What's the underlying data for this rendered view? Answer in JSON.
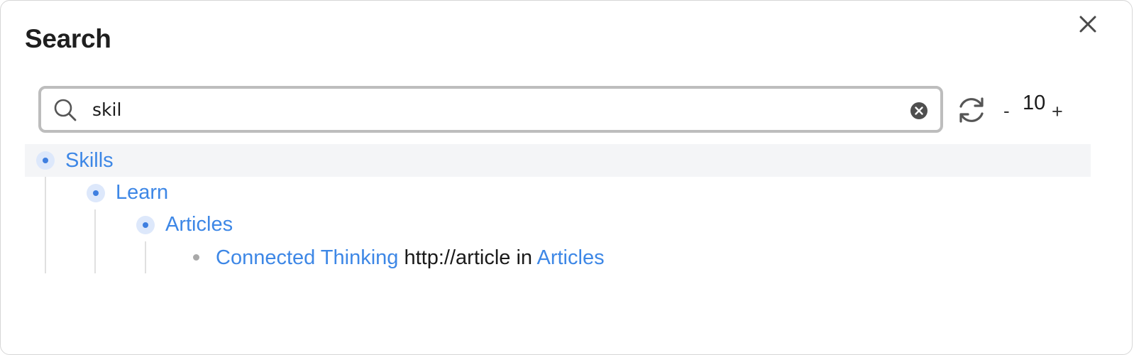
{
  "dialog": {
    "title": "Search",
    "close_icon": "close-icon"
  },
  "search": {
    "icon": "search-icon",
    "value": "skil",
    "placeholder": "",
    "clear_icon": "clear-circle-icon"
  },
  "controls": {
    "refresh_icon": "refresh-icon",
    "minus_label": "-",
    "depth_value": "10",
    "plus_label": "+"
  },
  "tree": {
    "level1": {
      "label": "Skills"
    },
    "level2": {
      "label": "Learn"
    },
    "level3": {
      "label": "Articles"
    },
    "result": {
      "title": "Connected Thinking",
      "url": "http://article",
      "in_text": "in",
      "parent": "Articles"
    }
  },
  "colors": {
    "link": "#3d87e6",
    "highlight_row": "#f4f5f7",
    "bullet_bg": "#dde8fb",
    "bullet_dot": "#3f7fe0"
  }
}
